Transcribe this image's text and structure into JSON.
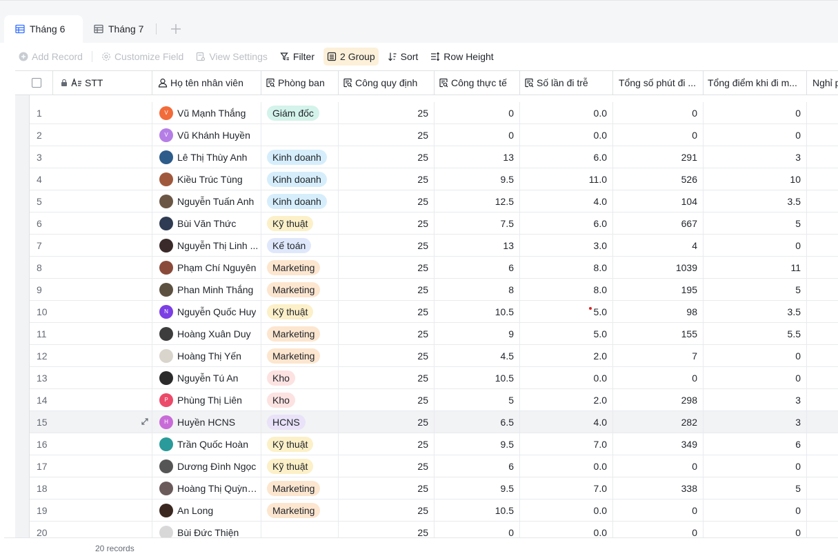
{
  "tabs": [
    {
      "label": "Tháng 6",
      "active": true
    },
    {
      "label": "Tháng 7",
      "active": false
    }
  ],
  "toolbar": {
    "add_record": "Add Record",
    "customize_field": "Customize Field",
    "view_settings": "View Settings",
    "filter": "Filter",
    "group": "2 Group",
    "sort": "Sort",
    "row_height": "Row Height"
  },
  "columns": [
    {
      "label": "STT",
      "icon": "text-icon"
    },
    {
      "label": "Họ tên nhân viên",
      "icon": "person-icon"
    },
    {
      "label": "Phòng ban",
      "icon": "lookup-icon"
    },
    {
      "label": "Công quy định",
      "icon": "lookup-icon"
    },
    {
      "label": "Công thực tế",
      "icon": "lookup-icon"
    },
    {
      "label": "Số lần đi trễ",
      "icon": "lookup-icon"
    },
    {
      "label": "Tổng số phút đi ...",
      "icon": "none"
    },
    {
      "label": "Tổng điểm khi đi m...",
      "icon": "none"
    },
    {
      "label": "Nghỉ p",
      "icon": "none"
    }
  ],
  "dept_colors": {
    "Giám đốc": "#d4f3ea",
    "Kinh doanh": "#d6eefb",
    "Kỹ thuật": "#fcf0c8",
    "Kế toán": "#dfe8fb",
    "Marketing": "#fde6cf",
    "Kho": "#fde2e2",
    "HCNS": "#e9e2f8"
  },
  "rows": [
    {
      "stt": "1",
      "name": "Vũ Mạnh Thắng",
      "dept": "Giám đốc",
      "cong_qd": "25",
      "cong_tt": "0",
      "tre": "0.0",
      "phut": "0",
      "diem": "0",
      "avatar": "#f26b3a",
      "initial": "V"
    },
    {
      "stt": "2",
      "name": "Vũ Khánh Huyền",
      "dept": "",
      "cong_qd": "25",
      "cong_tt": "0",
      "tre": "0.0",
      "phut": "0",
      "diem": "0",
      "avatar": "#b57ee6",
      "initial": "V"
    },
    {
      "stt": "3",
      "name": "Lê Thị Thùy Anh",
      "dept": "Kinh doanh",
      "cong_qd": "25",
      "cong_tt": "13",
      "tre": "6.0",
      "phut": "291",
      "diem": "3",
      "avatar": "#2d5b8a",
      "initial": ""
    },
    {
      "stt": "4",
      "name": "Kiều Trúc Tùng",
      "dept": "Kinh doanh",
      "cong_qd": "25",
      "cong_tt": "9.5",
      "tre": "11.0",
      "phut": "526",
      "diem": "10",
      "avatar": "#a0583c",
      "initial": ""
    },
    {
      "stt": "5",
      "name": "Nguyễn Tuấn Anh",
      "dept": "Kinh doanh",
      "cong_qd": "25",
      "cong_tt": "12.5",
      "tre": "4.0",
      "phut": "104",
      "diem": "3.5",
      "avatar": "#6b5646",
      "initial": ""
    },
    {
      "stt": "6",
      "name": "Bùi Văn Thức",
      "dept": "Kỹ thuật",
      "cong_qd": "25",
      "cong_tt": "7.5",
      "tre": "6.0",
      "phut": "667",
      "diem": "5",
      "avatar": "#2f3b52",
      "initial": ""
    },
    {
      "stt": "7",
      "name": "Nguyễn Thị Linh ...",
      "dept": "Kế toán",
      "cong_qd": "25",
      "cong_tt": "13",
      "tre": "3.0",
      "phut": "4",
      "diem": "0",
      "avatar": "#3a2a2a",
      "initial": ""
    },
    {
      "stt": "8",
      "name": "Phạm Chí Nguyên",
      "dept": "Marketing",
      "cong_qd": "25",
      "cong_tt": "6",
      "tre": "8.0",
      "phut": "1039",
      "diem": "11",
      "avatar": "#8a4a3a",
      "initial": ""
    },
    {
      "stt": "9",
      "name": "Phan Minh Thắng",
      "dept": "Marketing",
      "cong_qd": "25",
      "cong_tt": "8",
      "tre": "8.0",
      "phut": "195",
      "diem": "5",
      "avatar": "#5c5040",
      "initial": ""
    },
    {
      "stt": "10",
      "name": "Nguyễn Quốc Huy",
      "dept": "Kỹ thuật",
      "cong_qd": "25",
      "cong_tt": "10.5",
      "tre": "5.0",
      "phut": "98",
      "diem": "3.5",
      "avatar": "#7b3fe4",
      "initial": "N",
      "dot": true
    },
    {
      "stt": "11",
      "name": "Hoàng Xuân Duy",
      "dept": "Marketing",
      "cong_qd": "25",
      "cong_tt": "9",
      "tre": "5.0",
      "phut": "155",
      "diem": "5.5",
      "avatar": "#3d3d3d",
      "initial": ""
    },
    {
      "stt": "12",
      "name": "Hoàng Thị Yến",
      "dept": "Marketing",
      "cong_qd": "25",
      "cong_tt": "4.5",
      "tre": "2.0",
      "phut": "7",
      "diem": "0",
      "avatar": "#d9d4cc",
      "initial": ""
    },
    {
      "stt": "13",
      "name": "Nguyễn Tú An",
      "dept": "Kho",
      "cong_qd": "25",
      "cong_tt": "10.5",
      "tre": "0.0",
      "phut": "0",
      "diem": "0",
      "avatar": "#2b2b2b",
      "initial": ""
    },
    {
      "stt": "14",
      "name": "Phùng Thị Liên",
      "dept": "Kho",
      "cong_qd": "25",
      "cong_tt": "5",
      "tre": "2.0",
      "phut": "298",
      "diem": "3",
      "avatar": "#ec4a6a",
      "initial": "P"
    },
    {
      "stt": "15",
      "name": "Huyền HCNS",
      "dept": "HCNS",
      "cong_qd": "25",
      "cong_tt": "6.5",
      "tre": "4.0",
      "phut": "282",
      "diem": "3",
      "avatar": "#c86bd8",
      "initial": "H",
      "hover": true
    },
    {
      "stt": "16",
      "name": "Trần Quốc Hoàn",
      "dept": "Kỹ thuật",
      "cong_qd": "25",
      "cong_tt": "9.5",
      "tre": "7.0",
      "phut": "349",
      "diem": "6",
      "avatar": "#2a9a9a",
      "initial": ""
    },
    {
      "stt": "17",
      "name": "Dương Đình Ngọc",
      "dept": "Kỹ thuật",
      "cong_qd": "25",
      "cong_tt": "6",
      "tre": "0.0",
      "phut": "0",
      "diem": "0",
      "avatar": "#555555",
      "initial": ""
    },
    {
      "stt": "18",
      "name": "Hoàng Thị Quỳnh...",
      "dept": "Marketing",
      "cong_qd": "25",
      "cong_tt": "9.5",
      "tre": "7.0",
      "phut": "338",
      "diem": "5",
      "avatar": "#6a5a5a",
      "initial": ""
    },
    {
      "stt": "19",
      "name": "An Long",
      "dept": "Marketing",
      "cong_qd": "25",
      "cong_tt": "10.5",
      "tre": "0.0",
      "phut": "0",
      "diem": "0",
      "avatar": "#3a2820",
      "initial": ""
    },
    {
      "stt": "20",
      "name": "Bùi Đức Thiện",
      "dept": "",
      "cong_qd": "25",
      "cong_tt": "0",
      "tre": "0.0",
      "phut": "0",
      "diem": "0",
      "avatar": "#d8d8d8",
      "initial": ""
    }
  ],
  "footer": {
    "count": "20 records"
  }
}
